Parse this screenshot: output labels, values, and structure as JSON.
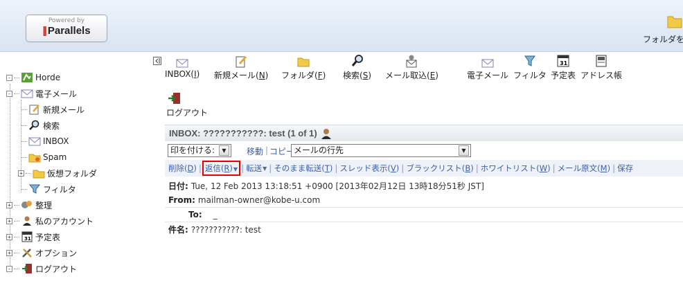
{
  "header": {
    "logo_powered": "Powered by",
    "logo_brand": "Parallels",
    "folder_label": "フォルダを"
  },
  "sidebar": {
    "items": [
      {
        "label": "Horde",
        "icon": "horde-icon"
      },
      {
        "label": "電子メール",
        "icon": "mail-icon"
      },
      {
        "label": "新規メール",
        "icon": "compose-icon"
      },
      {
        "label": "検索",
        "icon": "search-icon"
      },
      {
        "label": "INBOX",
        "icon": "inbox-icon"
      },
      {
        "label": "Spam",
        "icon": "spam-folder-icon"
      },
      {
        "label": "仮想フォルダ",
        "icon": "folder-icon"
      },
      {
        "label": "フィルタ",
        "icon": "filter-icon"
      },
      {
        "label": "整理",
        "icon": "organize-icon"
      },
      {
        "label": "私のアカウント",
        "icon": "account-icon"
      },
      {
        "label": "予定表",
        "icon": "calendar-icon"
      },
      {
        "label": "オプション",
        "icon": "options-icon"
      },
      {
        "label": "ログアウト",
        "icon": "logout-icon"
      }
    ]
  },
  "toolbar": {
    "inbox": {
      "text": "INBOX(",
      "key": "I",
      "end": ")"
    },
    "compose": {
      "text": "新規メール(",
      "key": "N",
      "end": ")"
    },
    "folders": {
      "text": "フォルダ(",
      "key": "F",
      "end": ")"
    },
    "search": {
      "text": "検索(",
      "key": "S",
      "end": ")"
    },
    "fetch": {
      "text": "メール取込(",
      "key": "E",
      "end": ")"
    },
    "email": "電子メール",
    "filter": "フィルタ",
    "calendar": "予定表",
    "addressbook": "アドレス帳",
    "logout": "ログアウト"
  },
  "message": {
    "title": "INBOX: ???????????: test (1 of 1)",
    "mark_select": "印を付ける:",
    "move": "移動",
    "copy": "コピー",
    "dest_select": "メールの行先",
    "actions": {
      "delete": {
        "text": "削除(",
        "key": "D",
        "end": ")"
      },
      "reply": {
        "text": "返信(",
        "key": "R",
        "end": ")"
      },
      "forward": "転送",
      "redirect": {
        "text": "そのまま転送(",
        "key": "T",
        "end": ")"
      },
      "thread": {
        "text": "スレッド表示(",
        "key": "V",
        "end": ")"
      },
      "blacklist": {
        "text": "ブラックリスト(",
        "key": "B",
        "end": ")"
      },
      "whitelist": {
        "text": "ホワイトリスト(",
        "key": "W",
        "end": ")"
      },
      "source": {
        "text": "メール原文(",
        "key": "M",
        "end": ")"
      },
      "save": "保存"
    },
    "headers": {
      "date_label": "日付:",
      "date_value": "Tue, 12 Feb 2013 13:18:51 +0900 [2013年02月12日 13時18分51秒 JST]",
      "from_label": "From:",
      "from_value": "mailman-owner@kobe-u.com",
      "to_label": "To:",
      "to_value": "_",
      "subject_label": "件名:",
      "subject_value": "???????????: test"
    }
  },
  "colors": {
    "link": "#3a5ea8",
    "highlight_box": "#e60000",
    "brand_red": "#e0261b"
  }
}
